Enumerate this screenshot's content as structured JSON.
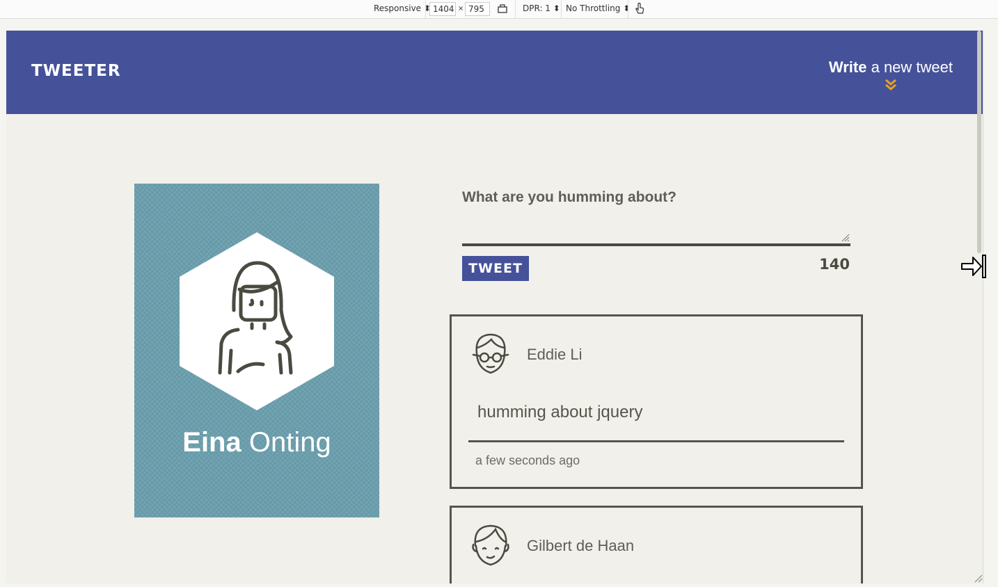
{
  "devtools": {
    "device": "Responsive",
    "width": "1404",
    "times": "×",
    "height": "795",
    "dpr": "DPR: 1",
    "throttling": "No Throttling"
  },
  "header": {
    "logo": "TWEETER",
    "compose_bold": "Write",
    "compose_rest": " a new tweet",
    "chevron_icon": "double-chevron-down-icon",
    "chevron_color": "#e8a21e",
    "background": "#45529a"
  },
  "profile": {
    "first_name": "Eina",
    "last_name": "Onting",
    "avatar_icon": "woman-avatar-icon",
    "background": "#6b9fae"
  },
  "composer": {
    "prompt": "What are you humming about?",
    "input_value": "",
    "button_label": "TWEET",
    "counter": "140"
  },
  "tweets": [
    {
      "author": "Eddie Li",
      "avatar_icon": "man-glasses-avatar-icon",
      "text": "humming about jquery",
      "time": "a few seconds ago"
    },
    {
      "author": "Gilbert de Haan",
      "avatar_icon": "man-avatar-icon",
      "text": "",
      "time": ""
    }
  ]
}
